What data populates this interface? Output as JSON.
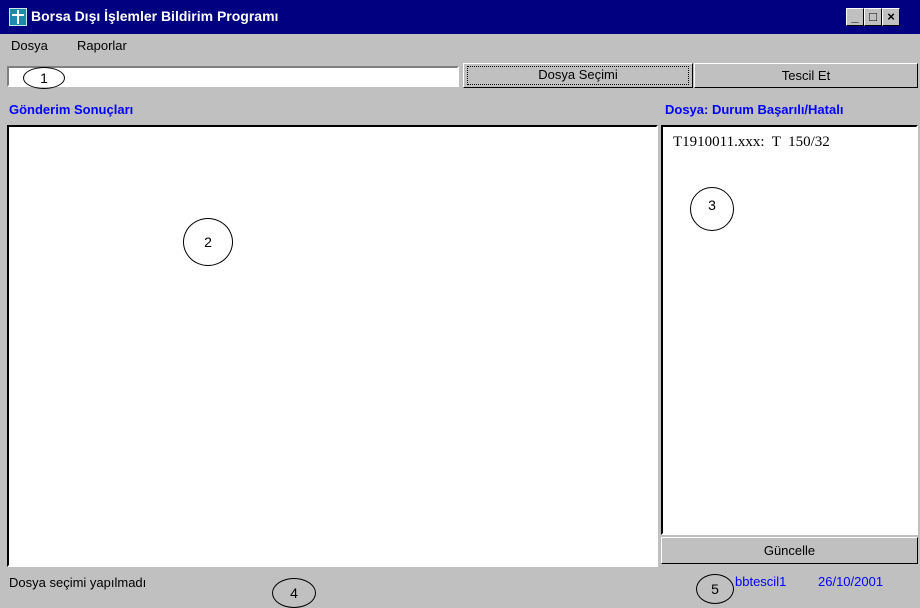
{
  "window": {
    "title": "Borsa Dışı İşlemler Bildirim Programı",
    "controls": {
      "minimize": "_",
      "maximize": "□",
      "close": "×"
    }
  },
  "menu": {
    "items": [
      "Dosya",
      "Raporlar"
    ]
  },
  "toolbar": {
    "file_input_value": "",
    "select_file_label": "Dosya Seçimi",
    "register_label": "Tescil Et"
  },
  "results": {
    "label": "Gönderim Sonuçları"
  },
  "file_status": {
    "label": "Dosya: Durum Başarılı/Hatalı",
    "items": [
      "T1910011.xxx:  T  150/32"
    ],
    "update_label": "Güncelle"
  },
  "statusbar": {
    "message": "Dosya seçimi yapılmadı",
    "user": "bbtescil1",
    "date": "26/10/2001"
  },
  "callouts": [
    "1",
    "2",
    "3",
    "4",
    "5"
  ],
  "icons": {
    "app": "borsa-logo-icon"
  },
  "colors": {
    "titlebar": "#000080",
    "accent_text": "#0000ff",
    "face": "#c0c0c0"
  }
}
